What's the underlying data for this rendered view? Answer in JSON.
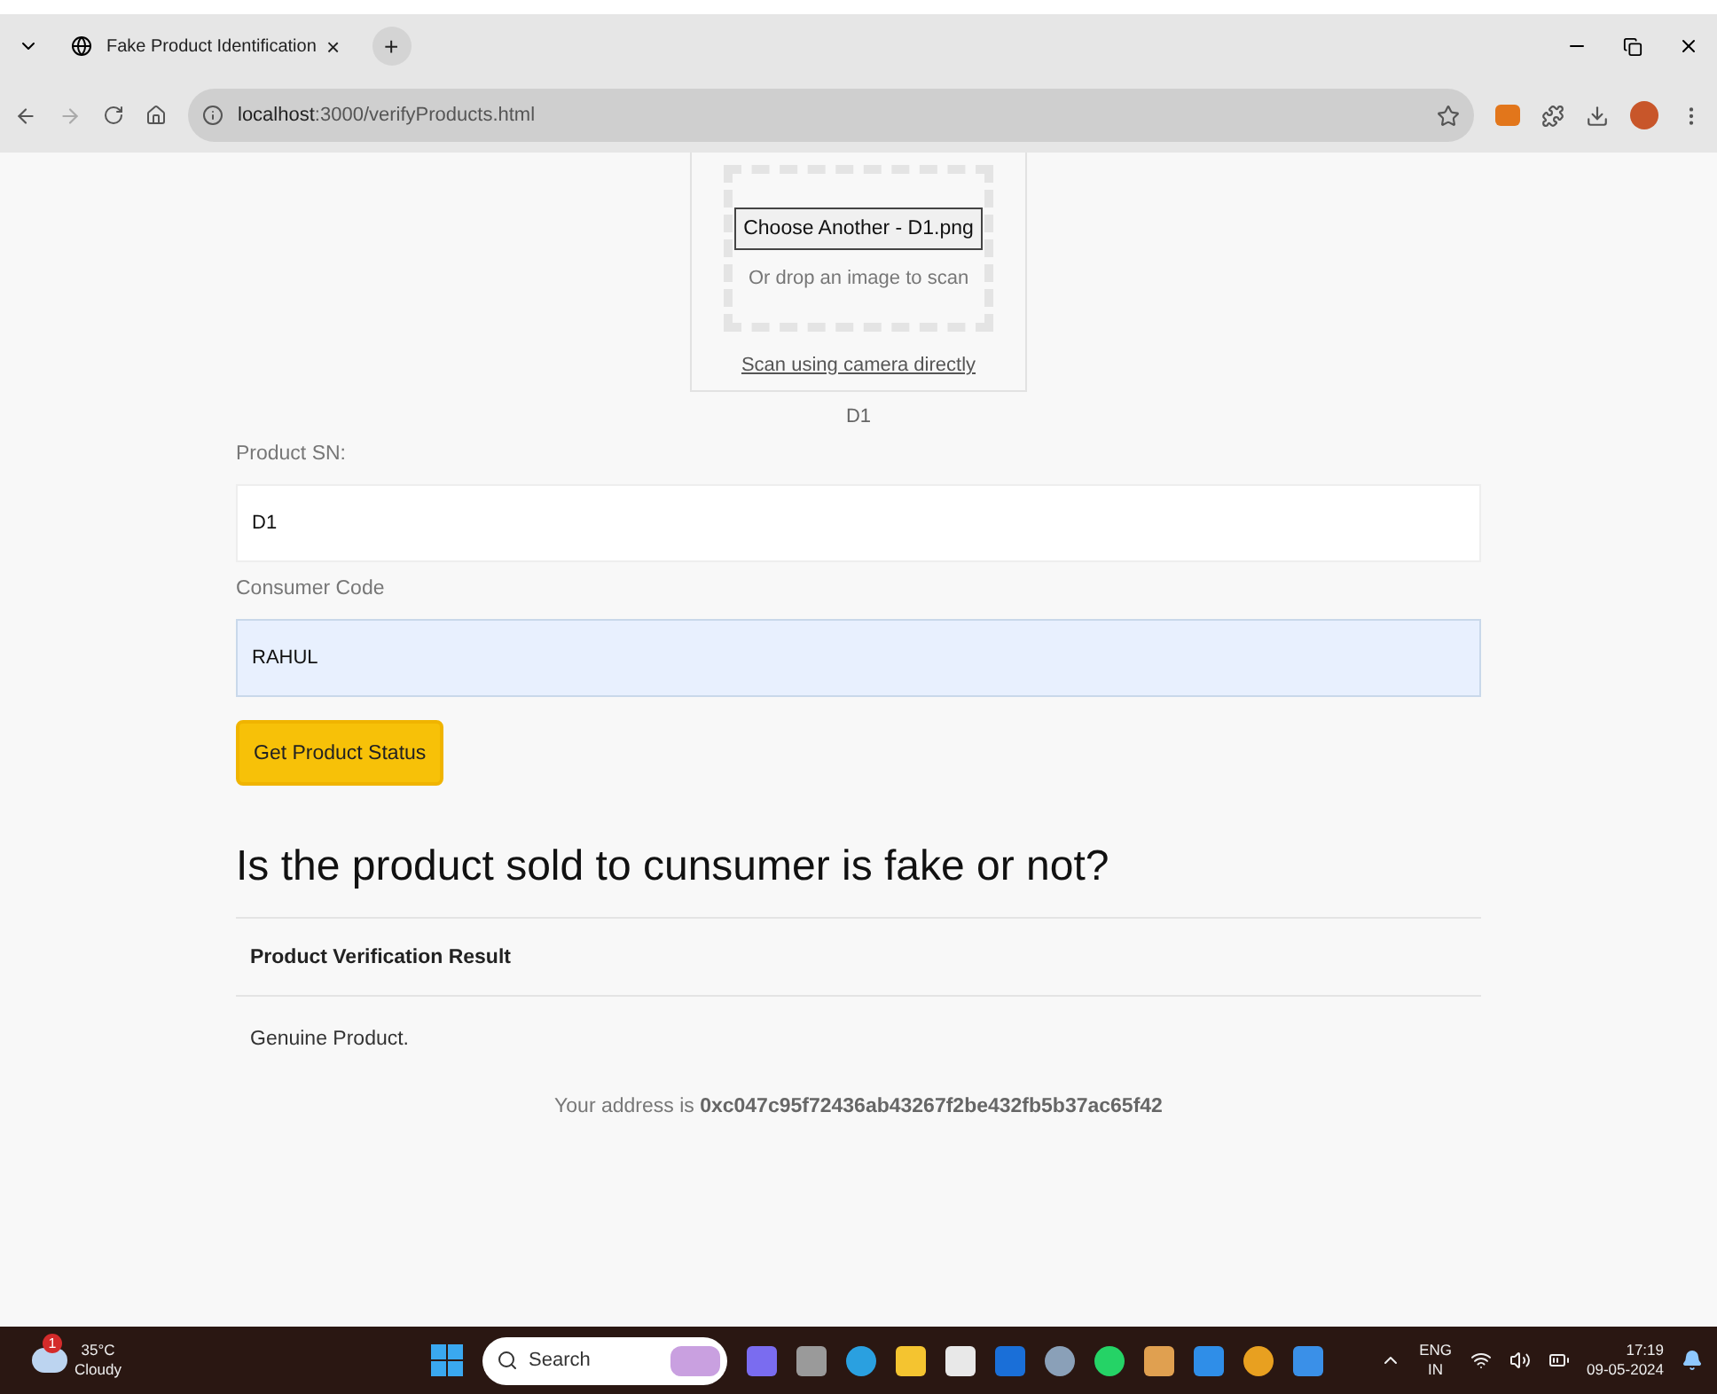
{
  "browser": {
    "tab": {
      "title": "Fake Product Identification",
      "close": "×",
      "new_tab": "+"
    },
    "address": "**localhost**:3000/verifyProducts.html"
  },
  "scanner": {
    "button": "Choose Another - D1.png",
    "drop_hint": "Or drop an image to scan",
    "camera_link": "Scan using camera directly",
    "result": "D1"
  },
  "form": {
    "fields": [
      {
        "label": "Product SN:",
        "value": "D1",
        "autofilled": false
      },
      {
        "label": "Consumer Code",
        "value": "RAHUL",
        "autofilled": true
      }
    ],
    "submit": "Get Product Status"
  },
  "heading": "Is the product sold to cunsumer is fake or not?",
  "result_table": {
    "header": "Product Verification Result",
    "rows": [
      "Genuine Product."
    ]
  },
  "address_line": "Your address is **0xc047c95f72436ab43267f2be432fb5b37ac65f42**",
  "taskbar": {
    "weather": {
      "badge": "1",
      "temperature": "35°C",
      "condition": "Cloudy"
    },
    "search": {
      "placeholder": "Search"
    },
    "language": {
      "code": "ENG",
      "region": "IN"
    },
    "time": "17:19",
    "date": "09-05-2024"
  }
}
